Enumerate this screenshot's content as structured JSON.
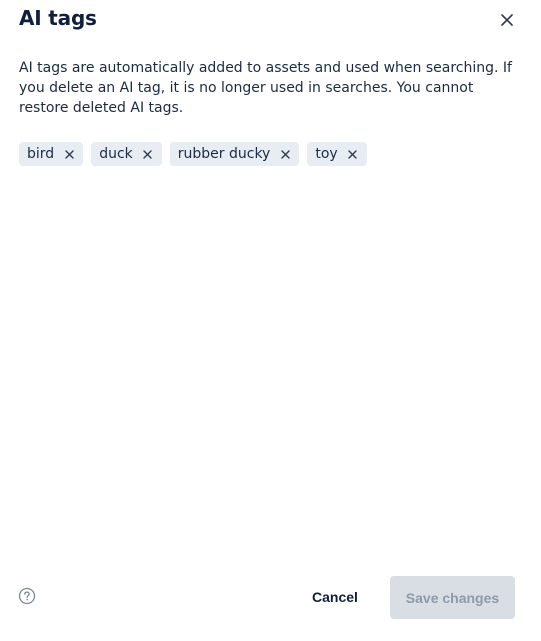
{
  "dialog": {
    "title": "AI tags",
    "description": "AI tags are automatically added to assets and used when searching. If you delete an AI tag, it is no longer used in searches. You cannot restore deleted AI tags."
  },
  "tags": [
    {
      "label": "bird"
    },
    {
      "label": "duck"
    },
    {
      "label": "rubber ducky"
    },
    {
      "label": "toy"
    }
  ],
  "footer": {
    "cancel_label": "Cancel",
    "save_label": "Save changes",
    "save_disabled": true
  },
  "icons": {
    "close": "close-icon",
    "tag_remove": "close-icon",
    "help": "question-circle-icon"
  },
  "colors": {
    "tag_background": "#e8edf3",
    "title_text": "#0f1f3d",
    "disabled_button_background": "#d9dee5",
    "disabled_button_text": "#8e99a8"
  }
}
